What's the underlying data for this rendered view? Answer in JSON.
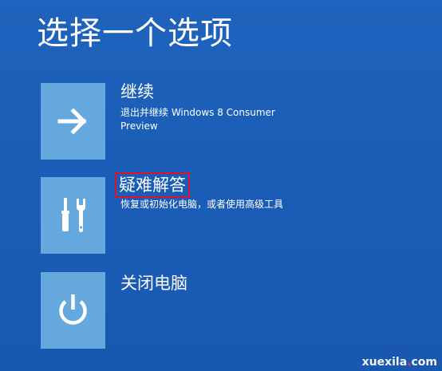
{
  "page": {
    "title": "选择一个选项"
  },
  "options": [
    {
      "id": "continue",
      "title": "继续",
      "description": "退出并继续 Windows 8 Consumer Preview",
      "icon": "arrow-right-icon"
    },
    {
      "id": "troubleshoot",
      "title": "疑难解答",
      "description": "恢复或初始化电脑，或者使用高级工具",
      "icon": "tools-icon",
      "highlighted": true
    },
    {
      "id": "shutdown",
      "title": "关闭电脑",
      "description": "",
      "icon": "power-icon"
    }
  ],
  "watermark": {
    "main": "xuexila",
    "dot": ".",
    "tld": "com"
  },
  "colors": {
    "background": "#1b5fb8",
    "tile": "#64a8dd",
    "highlight_border": "#e0122b",
    "text": "#ffffff"
  }
}
